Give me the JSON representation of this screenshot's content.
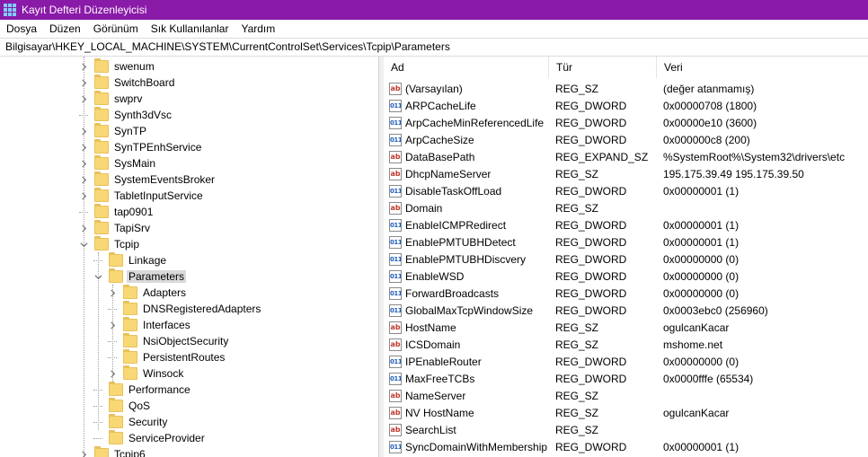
{
  "window": {
    "title": "Kayıt Defteri Düzenleyicisi"
  },
  "menu": {
    "items": [
      "Dosya",
      "Düzen",
      "Görünüm",
      "Sık Kullanılanlar",
      "Yardım"
    ]
  },
  "address": {
    "path": "Bilgisayar\\HKEY_LOCAL_MACHINE\\SYSTEM\\CurrentControlSet\\Services\\Tcpip\\Parameters"
  },
  "tree": {
    "nodes": [
      {
        "label": "swenum",
        "level": 0,
        "expander": "collapsed"
      },
      {
        "label": "SwitchBoard",
        "level": 0,
        "expander": "collapsed"
      },
      {
        "label": "swprv",
        "level": 0,
        "expander": "collapsed"
      },
      {
        "label": "Synth3dVsc",
        "level": 0,
        "expander": "none"
      },
      {
        "label": "SynTP",
        "level": 0,
        "expander": "collapsed"
      },
      {
        "label": "SynTPEnhService",
        "level": 0,
        "expander": "collapsed"
      },
      {
        "label": "SysMain",
        "level": 0,
        "expander": "collapsed"
      },
      {
        "label": "SystemEventsBroker",
        "level": 0,
        "expander": "collapsed"
      },
      {
        "label": "TabletInputService",
        "level": 0,
        "expander": "collapsed"
      },
      {
        "label": "tap0901",
        "level": 0,
        "expander": "none"
      },
      {
        "label": "TapiSrv",
        "level": 0,
        "expander": "collapsed"
      },
      {
        "label": "Tcpip",
        "level": 0,
        "expander": "expanded"
      },
      {
        "label": "Linkage",
        "level": 1,
        "expander": "none"
      },
      {
        "label": "Parameters",
        "level": 1,
        "expander": "expanded",
        "selected": true
      },
      {
        "label": "Adapters",
        "level": 2,
        "expander": "collapsed"
      },
      {
        "label": "DNSRegisteredAdapters",
        "level": 2,
        "expander": "none"
      },
      {
        "label": "Interfaces",
        "level": 2,
        "expander": "collapsed"
      },
      {
        "label": "NsiObjectSecurity",
        "level": 2,
        "expander": "none"
      },
      {
        "label": "PersistentRoutes",
        "level": 2,
        "expander": "none"
      },
      {
        "label": "Winsock",
        "level": 2,
        "expander": "collapsed"
      },
      {
        "label": "Performance",
        "level": 1,
        "expander": "none"
      },
      {
        "label": "QoS",
        "level": 1,
        "expander": "none"
      },
      {
        "label": "Security",
        "level": 1,
        "expander": "none"
      },
      {
        "label": "ServiceProvider",
        "level": 1,
        "expander": "none"
      },
      {
        "label": "Tcpip6",
        "level": 0,
        "expander": "collapsed"
      }
    ]
  },
  "list": {
    "headers": {
      "name": "Ad",
      "type": "Tür",
      "data": "Veri"
    },
    "rows": [
      {
        "icon": "sz",
        "name": "(Varsayılan)",
        "type": "REG_SZ",
        "data": "(değer atanmamış)"
      },
      {
        "icon": "dw",
        "name": "ARPCacheLife",
        "type": "REG_DWORD",
        "data": "0x00000708 (1800)"
      },
      {
        "icon": "dw",
        "name": "ArpCacheMinReferencedLife",
        "type": "REG_DWORD",
        "data": "0x00000e10 (3600)"
      },
      {
        "icon": "dw",
        "name": "ArpCacheSize",
        "type": "REG_DWORD",
        "data": "0x000000c8 (200)"
      },
      {
        "icon": "sz",
        "name": "DataBasePath",
        "type": "REG_EXPAND_SZ",
        "data": "%SystemRoot%\\System32\\drivers\\etc"
      },
      {
        "icon": "sz",
        "name": "DhcpNameServer",
        "type": "REG_SZ",
        "data": "195.175.39.49 195.175.39.50"
      },
      {
        "icon": "dw",
        "name": "DisableTaskOffLoad",
        "type": "REG_DWORD",
        "data": "0x00000001 (1)"
      },
      {
        "icon": "sz",
        "name": "Domain",
        "type": "REG_SZ",
        "data": ""
      },
      {
        "icon": "dw",
        "name": "EnableICMPRedirect",
        "type": "REG_DWORD",
        "data": "0x00000001 (1)"
      },
      {
        "icon": "dw",
        "name": "EnablePMTUBHDetect",
        "type": "REG_DWORD",
        "data": "0x00000001 (1)"
      },
      {
        "icon": "dw",
        "name": "EnablePMTUBHDiscvery",
        "type": "REG_DWORD",
        "data": "0x00000000 (0)"
      },
      {
        "icon": "dw",
        "name": "EnableWSD",
        "type": "REG_DWORD",
        "data": "0x00000000 (0)"
      },
      {
        "icon": "dw",
        "name": "ForwardBroadcasts",
        "type": "REG_DWORD",
        "data": "0x00000000 (0)"
      },
      {
        "icon": "dw",
        "name": "GlobalMaxTcpWindowSize",
        "type": "REG_DWORD",
        "data": "0x0003ebc0 (256960)"
      },
      {
        "icon": "sz",
        "name": "HostName",
        "type": "REG_SZ",
        "data": "ogulcanKacar"
      },
      {
        "icon": "sz",
        "name": "ICSDomain",
        "type": "REG_SZ",
        "data": "mshome.net"
      },
      {
        "icon": "dw",
        "name": "IPEnableRouter",
        "type": "REG_DWORD",
        "data": "0x00000000 (0)"
      },
      {
        "icon": "dw",
        "name": "MaxFreeTCBs",
        "type": "REG_DWORD",
        "data": "0x0000fffe (65534)"
      },
      {
        "icon": "sz",
        "name": "NameServer",
        "type": "REG_SZ",
        "data": ""
      },
      {
        "icon": "sz",
        "name": "NV HostName",
        "type": "REG_SZ",
        "data": "ogulcanKacar"
      },
      {
        "icon": "sz",
        "name": "SearchList",
        "type": "REG_SZ",
        "data": ""
      },
      {
        "icon": "dw",
        "name": "SyncDomainWithMembership",
        "type": "REG_DWORD",
        "data": "0x00000001 (1)"
      }
    ]
  },
  "icons": {
    "sz": "ab",
    "dw": "011"
  },
  "colors": {
    "titlebar": "#8a1aa8",
    "selection": "#d9d9d9",
    "folder": "#f8d775"
  }
}
